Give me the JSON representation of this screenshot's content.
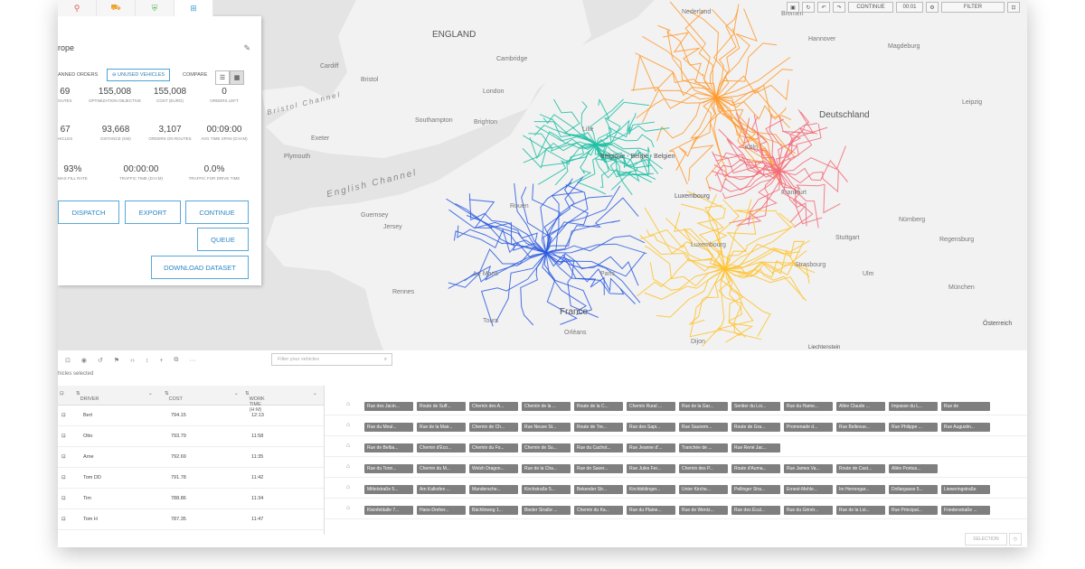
{
  "map_labels": {
    "countries": [
      "ENGLAND",
      "Deutschland",
      "Belgique - België - Belgien",
      "Luxembourg",
      "France",
      "Österreich",
      "Jersey",
      "Guernsey",
      "Nederland"
    ],
    "seas": [
      "English Channel",
      "Bristol Channel"
    ],
    "cities": [
      "Magdeburg",
      "Hannover",
      "Köln",
      "Bremen",
      "Frankfurt",
      "Nürnberg",
      "Regensburg",
      "Ulm",
      "München",
      "Leipzig",
      "Luxembourg",
      "Lille",
      "London",
      "Southampton",
      "Bristol",
      "Exeter",
      "Cambridge",
      "Brighton",
      "Rouen",
      "Le Mans",
      "Tours",
      "Dijon",
      "Strasbourg",
      "Stuttgart",
      "Rennes",
      "Paris",
      "Orléans",
      "Plymouth",
      "Cardiff"
    ],
    "bottom": "Liechtenstein"
  },
  "map_toolbar": {
    "continue_label": "CONTINUE",
    "time": "00:01",
    "filter_label": "FILTER"
  },
  "panel": {
    "title": "rope",
    "tabs": [
      "pin-icon",
      "truck-icon",
      "shield-icon",
      "map-icon"
    ],
    "segments": {
      "planned": "ANNED ORDERS",
      "unused": "UNUSED VEHICLES",
      "compare": "COMPARE"
    },
    "stats": [
      {
        "value": "69",
        "label": "OUTES"
      },
      {
        "value": "155,008",
        "label": "OPTIMIZATION OBJECTIVE"
      },
      {
        "value": "155,008",
        "label": "COST (EURO)"
      },
      {
        "value": "0",
        "label": "ORDERS LEFT"
      },
      {
        "value": "67",
        "label": "HICLES"
      },
      {
        "value": "93,668",
        "label": "DISTANCE (KM)"
      },
      {
        "value": "3,107",
        "label": "ORDERS ON ROUTES"
      },
      {
        "value": "00:09:00",
        "label": "AVG TIME SPAN (D:H:M)"
      },
      {
        "value": "93%",
        "label": "MAX FILL RATE"
      },
      {
        "value": "00:00:00",
        "label": "TRAFFIC TIME (D:H:M)"
      },
      {
        "value": "0.0%",
        "label": "TRAFFIC FOR DRIVE TIME"
      }
    ],
    "buttons": {
      "dispatch": "DISPATCH",
      "export": "EXPORT",
      "continue": "CONTINUE",
      "queue": "QUEUE",
      "download": "DOWNLOAD DATASET"
    }
  },
  "vehicles": {
    "search_placeholder": "Filter your vehicles",
    "selected_text": "hicles selected",
    "columns": {
      "driver": "DRIVER",
      "cost": "COST",
      "work_time": "WORK TIME (H:M)"
    },
    "rows": [
      {
        "driver": "Bert",
        "cost": "794.15",
        "work": "12:13"
      },
      {
        "driver": "Otto",
        "cost": "793.79",
        "work": "11:58"
      },
      {
        "driver": "Arne",
        "cost": "792.69",
        "work": "11:35"
      },
      {
        "driver": "Tom DD",
        "cost": "791.78",
        "work": "11:42"
      },
      {
        "driver": "Tim",
        "cost": "788.86",
        "work": "11:34"
      },
      {
        "driver": "Tom H",
        "cost": "787.35",
        "work": "11:47"
      }
    ]
  },
  "gantt": [
    [
      "Rue des Jacin...",
      "Route de Suff...",
      "Chemin des A...",
      "Chemin de la ...",
      "Route de la C...",
      "Chemin Rural ...",
      "Rue de la Gar...",
      "Sentier du Loi...",
      "Rue du Hame...",
      "Allée Claude ...",
      "Impasse du L...",
      "Rue de"
    ],
    [
      "Rue du Moul...",
      "Rue de la Mair...",
      "Chemin de Ch...",
      "Rue Neuve St...",
      "Route de Tre...",
      "Rue des Sapi...",
      "Rue Saunem...",
      "Route de Gra...",
      "Promenade d...",
      "Rue Bellevue...",
      "Rue Philippe ...",
      "Rue Augustin..."
    ],
    [
      "Rue de Belba...",
      "Chemin d'Eco...",
      "Chemin du Fo...",
      "Chemin de Su...",
      "Rue du Cachot...",
      "Rue Jeanne d'...",
      "Tranchée de ...",
      "Rue René Jac..."
    ],
    [
      "Rue du Tonn...",
      "Chemin du M...",
      "Welsh Dragon...",
      "Rue de la Cha...",
      "Rue de Saver...",
      "Rue Jules Fer...",
      "Chemin des P...",
      "Route d'Auma...",
      "Rue James Va...",
      "Route de Cast...",
      "Allée Pontus..."
    ],
    [
      "Mittelstraße 5...",
      "Am Kalkofen ...",
      "Mandersche...",
      "Kirchstraße 5...",
      "Bekender Str...",
      "Kirchbildinger...",
      "Unter Kirche...",
      "Pellinger Stra...",
      "Ernest-Mehle...",
      "Im Herrengar...",
      "Dollargasse 5...",
      "Lieweringstraße"
    ],
    [
      "Kleinfeldalle 7...",
      "Hans-Dreher...",
      "Bächlinweg 1...",
      "Bieder Straße ...",
      "Chemin du Ka...",
      "Rue du Plaine...",
      "Rue de Wentz...",
      "Rue des Écul...",
      "Rue du Génér...",
      "Rue de la Loi...",
      "Rue Principal...",
      "Friedenstraße ..."
    ]
  ],
  "bottombar": {
    "selection": "SELECTION"
  },
  "colors": {
    "accent": "#4aa3d6",
    "teal": "#1fc0a5",
    "orange": "#ff9a2e",
    "pink": "#f26b78",
    "blue": "#2c5be0",
    "yellow": "#ffc22b"
  }
}
